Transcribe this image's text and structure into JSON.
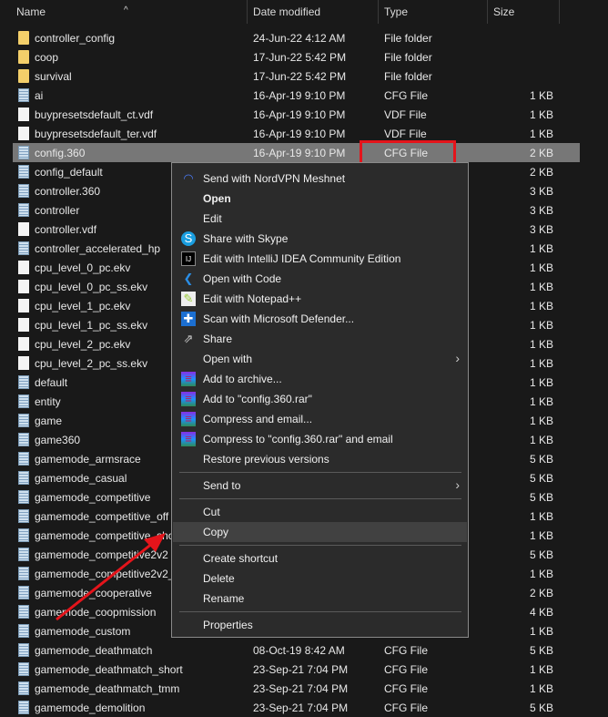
{
  "columns": {
    "name": "Name",
    "date": "Date modified",
    "type": "Type",
    "size": "Size"
  },
  "files": [
    {
      "name": "controller_config",
      "date": "24-Jun-22 4:12 AM",
      "type": "File folder",
      "size": "",
      "icon": "folder"
    },
    {
      "name": "coop",
      "date": "17-Jun-22 5:42 PM",
      "type": "File folder",
      "size": "",
      "icon": "folder"
    },
    {
      "name": "survival",
      "date": "17-Jun-22 5:42 PM",
      "type": "File folder",
      "size": "",
      "icon": "folder"
    },
    {
      "name": "ai",
      "date": "16-Apr-19 9:10 PM",
      "type": "CFG File",
      "size": "1 KB",
      "icon": "cfg"
    },
    {
      "name": "buypresetsdefault_ct.vdf",
      "date": "16-Apr-19 9:10 PM",
      "type": "VDF File",
      "size": "1 KB",
      "icon": "blank"
    },
    {
      "name": "buypresetsdefault_ter.vdf",
      "date": "16-Apr-19 9:10 PM",
      "type": "VDF File",
      "size": "1 KB",
      "icon": "blank"
    },
    {
      "name": "config.360",
      "date": "16-Apr-19 9:10 PM",
      "type": "CFG File",
      "size": "2 KB",
      "icon": "cfg",
      "selected": true
    },
    {
      "name": "config_default",
      "size": "2 KB",
      "icon": "cfg"
    },
    {
      "name": "controller.360",
      "size": "3 KB",
      "icon": "cfg"
    },
    {
      "name": "controller",
      "size": "3 KB",
      "icon": "cfg"
    },
    {
      "name": "controller.vdf",
      "size": "3 KB",
      "icon": "blank"
    },
    {
      "name": "controller_accelerated_hp",
      "size": "1 KB",
      "icon": "cfg"
    },
    {
      "name": "cpu_level_0_pc.ekv",
      "size": "1 KB",
      "icon": "blank"
    },
    {
      "name": "cpu_level_0_pc_ss.ekv",
      "size": "1 KB",
      "icon": "blank"
    },
    {
      "name": "cpu_level_1_pc.ekv",
      "size": "1 KB",
      "icon": "blank"
    },
    {
      "name": "cpu_level_1_pc_ss.ekv",
      "size": "1 KB",
      "icon": "blank"
    },
    {
      "name": "cpu_level_2_pc.ekv",
      "size": "1 KB",
      "icon": "blank"
    },
    {
      "name": "cpu_level_2_pc_ss.ekv",
      "size": "1 KB",
      "icon": "blank"
    },
    {
      "name": "default",
      "size": "1 KB",
      "icon": "cfg"
    },
    {
      "name": "entity",
      "size": "1 KB",
      "icon": "cfg"
    },
    {
      "name": "game",
      "size": "1 KB",
      "icon": "cfg"
    },
    {
      "name": "game360",
      "size": "1 KB",
      "icon": "cfg"
    },
    {
      "name": "gamemode_armsrace",
      "size": "5 KB",
      "icon": "cfg"
    },
    {
      "name": "gamemode_casual",
      "size": "5 KB",
      "icon": "cfg"
    },
    {
      "name": "gamemode_competitive",
      "size": "5 KB",
      "icon": "cfg"
    },
    {
      "name": "gamemode_competitive_off",
      "size": "1 KB",
      "icon": "cfg"
    },
    {
      "name": "gamemode_competitive_sho",
      "size": "1 KB",
      "icon": "cfg"
    },
    {
      "name": "gamemode_competitive2v2",
      "size": "5 KB",
      "icon": "cfg"
    },
    {
      "name": "gamemode_competitive2v2_",
      "size": "1 KB",
      "icon": "cfg"
    },
    {
      "name": "gamemode_cooperative",
      "size": "2 KB",
      "icon": "cfg"
    },
    {
      "name": "gamemode_coopmission",
      "size": "4 KB",
      "icon": "cfg"
    },
    {
      "name": "gamemode_custom",
      "size": "1 KB",
      "icon": "cfg"
    },
    {
      "name": "gamemode_deathmatch",
      "date": "08-Oct-19 8:42 AM",
      "type": "CFG File",
      "size": "5 KB",
      "icon": "cfg"
    },
    {
      "name": "gamemode_deathmatch_short",
      "date": "23-Sep-21 7:04 PM",
      "type": "CFG File",
      "size": "1 KB",
      "icon": "cfg"
    },
    {
      "name": "gamemode_deathmatch_tmm",
      "date": "23-Sep-21 7:04 PM",
      "type": "CFG File",
      "size": "1 KB",
      "icon": "cfg"
    },
    {
      "name": "gamemode_demolition",
      "date": "23-Sep-21 7:04 PM",
      "type": "CFG File",
      "size": "5 KB",
      "icon": "cfg"
    }
  ],
  "menu": [
    {
      "label": "Send with NordVPN Meshnet",
      "icon": "nordvpn-icon"
    },
    {
      "label": "Open",
      "bold": true
    },
    {
      "label": "Edit"
    },
    {
      "label": "Share with Skype",
      "icon": "skype-icon"
    },
    {
      "label": "Edit with IntelliJ IDEA Community Edition",
      "icon": "intellij-icon"
    },
    {
      "label": "Open with Code",
      "icon": "vscode-icon"
    },
    {
      "label": "Edit with Notepad++",
      "icon": "notepadpp-icon"
    },
    {
      "label": "Scan with Microsoft Defender...",
      "icon": "defender-icon"
    },
    {
      "label": "Share",
      "icon": "share-icon"
    },
    {
      "label": "Open with",
      "submenu": true
    },
    {
      "label": "Add to archive...",
      "icon": "winrar-icon"
    },
    {
      "label": "Add to \"config.360.rar\"",
      "icon": "winrar-icon"
    },
    {
      "label": "Compress and email...",
      "icon": "winrar-icon"
    },
    {
      "label": "Compress to \"config.360.rar\" and email",
      "icon": "winrar-icon"
    },
    {
      "label": "Restore previous versions"
    },
    {
      "sep": true
    },
    {
      "label": "Send to",
      "submenu": true
    },
    {
      "sep": true
    },
    {
      "label": "Cut"
    },
    {
      "label": "Copy",
      "highlighted": true
    },
    {
      "sep": true
    },
    {
      "label": "Create shortcut"
    },
    {
      "label": "Delete"
    },
    {
      "label": "Rename"
    },
    {
      "sep": true
    },
    {
      "label": "Properties"
    }
  ],
  "colors": {
    "highlight": "#e4141b",
    "selected_row": "#777777",
    "menu_bg": "#2b2b2b"
  }
}
